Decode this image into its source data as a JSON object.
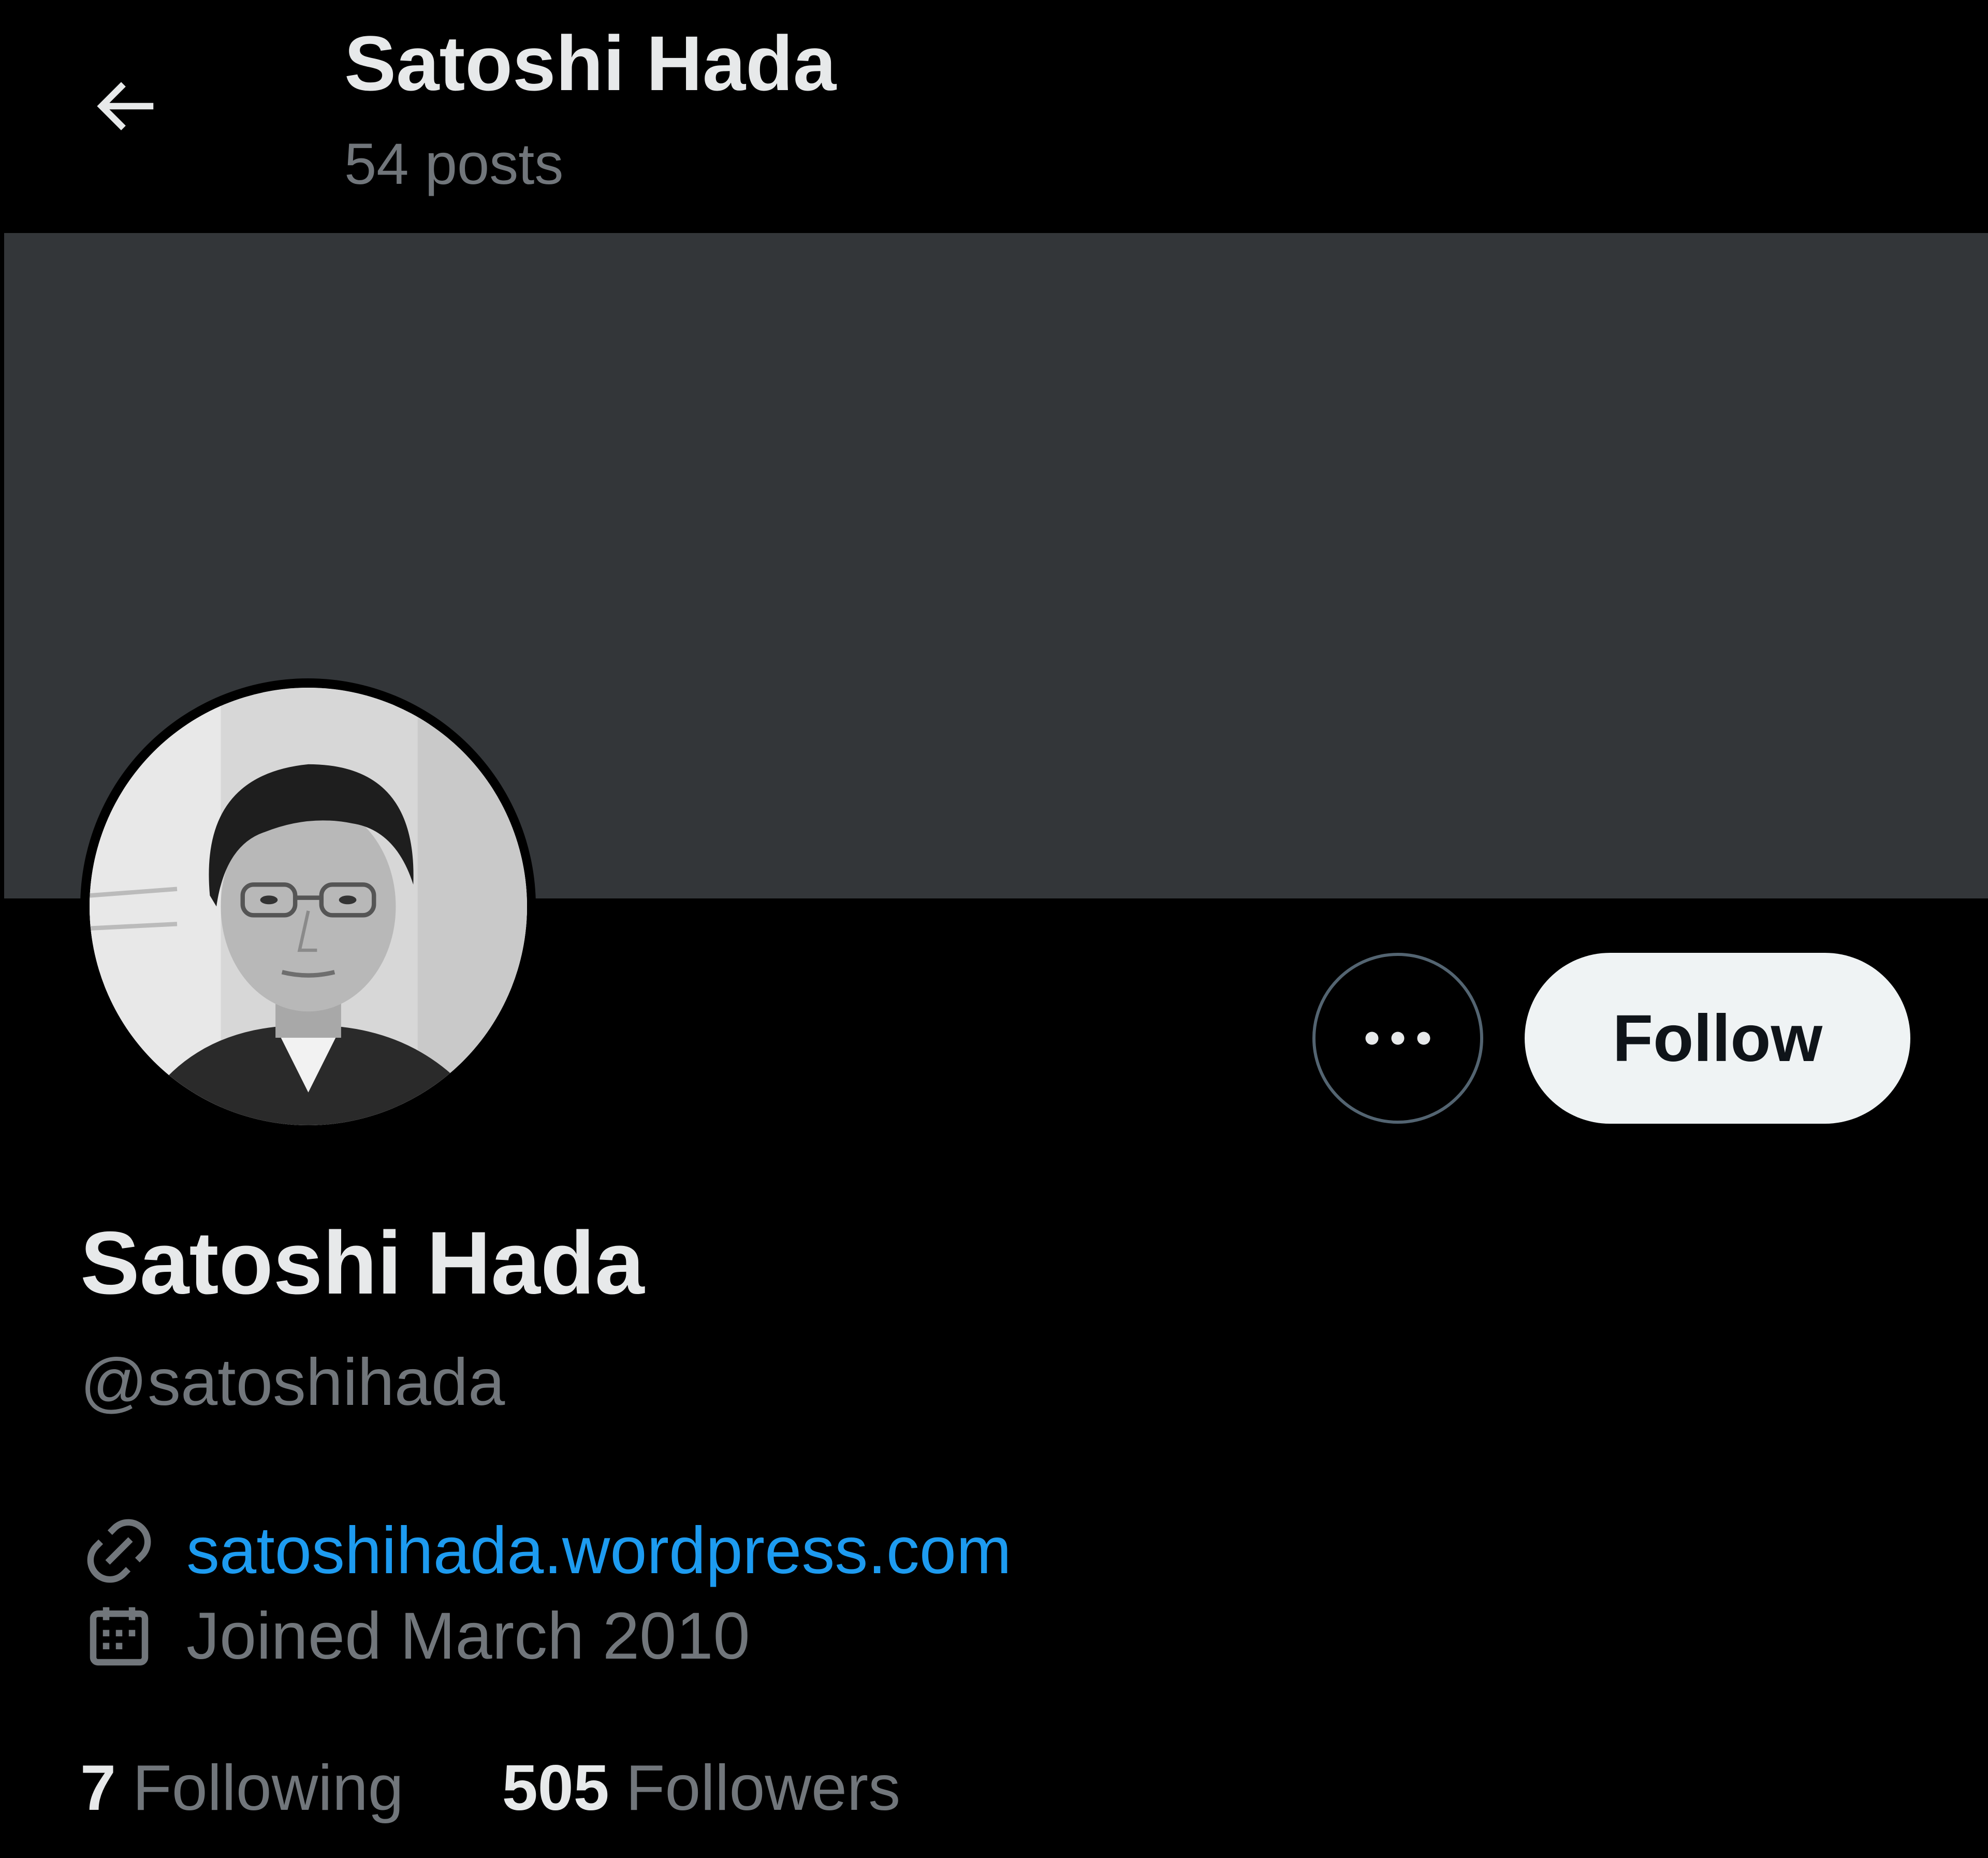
{
  "header": {
    "back_icon": "arrow-left-icon",
    "title": "Satoshi Hada",
    "post_count": "54 posts"
  },
  "banner": {
    "color": "#333639"
  },
  "profile": {
    "avatar_icon": "profile-photo",
    "display_name": "Satoshi Hada",
    "handle": "@satoshihada",
    "website": "satoshihada.wordpress.com",
    "website_icon": "link-icon",
    "joined": "Joined March 2010",
    "joined_icon": "calendar-icon"
  },
  "actions": {
    "more_icon": "more-options-icon",
    "follow_label": "Follow"
  },
  "stats": {
    "following_count": "7",
    "following_label": "Following",
    "followers_count": "505",
    "followers_label": "Followers"
  },
  "colors": {
    "background": "#000000",
    "primary_text": "#e7e9ea",
    "secondary_text": "#71767b",
    "link": "#1d9bf0",
    "follow_button_bg": "#eff3f4"
  }
}
